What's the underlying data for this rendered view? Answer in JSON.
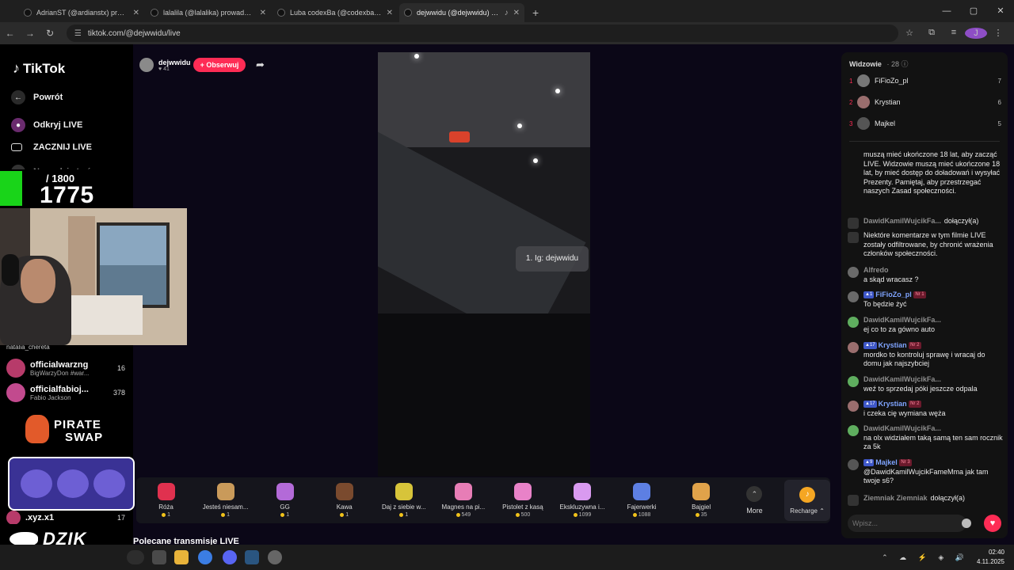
{
  "browser": {
    "tabs": [
      {
        "label": "AdrianST (@ardianstx) prowadzi LIVE",
        "active": false
      },
      {
        "label": "lalalila (@lalalika) prowadzi LIVE",
        "active": false
      },
      {
        "label": "Luba codexBa (@codexba369)",
        "active": false
      },
      {
        "label": "dejwwidu (@dejwwidu) prowadzi LIVE",
        "active": true
      }
    ],
    "url": "tiktok.com/@dejwwidu/live",
    "profile_initial": "J"
  },
  "sidebar": {
    "brand": "TikTok",
    "back_label": "Powrót",
    "discover_label": "Odkryj LIVE",
    "go_live_label": "ZACZNIJ LIVE",
    "creator_tools_label": "Narzędzia twórcy",
    "accounts": [
      {
        "name": "natalia_chereta",
        "sub": "",
        "count": ""
      },
      {
        "name": "officialwarzng",
        "sub": "BigWarzyDon #war...",
        "count": "16"
      },
      {
        "name": "officialfabioj...",
        "sub": "Fabio Jackson",
        "count": "378"
      },
      {
        "name": ".xyz.x1",
        "sub": "",
        "count": "17"
      }
    ]
  },
  "overlay": {
    "counter_total": "/ 1800",
    "counter_current": "1775",
    "pirate_line1": "PIRATE",
    "pirate_line2": "SWAP",
    "dzik_label": "DZIK"
  },
  "stream": {
    "host_name": "dejwwidu",
    "host_likes": "41",
    "follow_label": "+ Obserwuj",
    "tooltip": "1. Ig: dejwwidu",
    "recommended_label": "Polecane transmisje LIVE"
  },
  "gifts": [
    {
      "name": "Róża",
      "price": "1",
      "color": "#e0314f"
    },
    {
      "name": "Jesteś niesam...",
      "price": "1",
      "color": "#c99a5a"
    },
    {
      "name": "GG",
      "price": "1",
      "color": "#b36ad8"
    },
    {
      "name": "Kawa",
      "price": "1",
      "color": "#7a4a2e"
    },
    {
      "name": "Daj z siebie w...",
      "price": "1",
      "color": "#d7c43a"
    },
    {
      "name": "Magnes na pi...",
      "price": "549",
      "color": "#e77db6"
    },
    {
      "name": "Pistolet z kasą",
      "price": "500",
      "color": "#e882c8"
    },
    {
      "name": "Ekskluzywna i...",
      "price": "1099",
      "color": "#d99af0"
    },
    {
      "name": "Fajerwerki",
      "price": "1088",
      "color": "#5d7fe3"
    },
    {
      "name": "Bajgiel",
      "price": "35",
      "color": "#e0a24a"
    }
  ],
  "gift_more_label": "More",
  "recharge_label": "Recharge",
  "viewers": {
    "title": "Widzowie",
    "count": "28",
    "top": [
      {
        "rank": "1",
        "name": "FiFioZo_pl",
        "score": "7"
      },
      {
        "rank": "2",
        "name": "Krystian",
        "score": "6"
      },
      {
        "rank": "3",
        "name": "Majkel",
        "score": "5"
      }
    ]
  },
  "chat": [
    {
      "type": "system",
      "user": "",
      "text": "muszą mieć ukończone 18 lat, aby zacząć LIVE. Widzowie muszą mieć ukończone 18 lat, by mieć dostęp do doładowań i wysyłać Prezenty. Pamiętaj, aby przestrzegać naszych Zasad społeczności."
    },
    {
      "type": "join",
      "user": "DawidKamilWujcikFa...",
      "text": "dołączył(a)"
    },
    {
      "type": "system",
      "user": "",
      "text": "Niektóre komentarze w tym filmie LIVE zostały odfiltrowane, by chronić wrażenia członków społeczności."
    },
    {
      "type": "comment",
      "user": "Alfredo",
      "level": "",
      "nr": "",
      "text": "a skąd wracasz ?"
    },
    {
      "type": "comment",
      "user": "FiFioZo_pl",
      "level": "1",
      "nr": "Nr 1",
      "text": "To będzie żyć"
    },
    {
      "type": "comment",
      "user": "DawidKamilWujcikFa...",
      "level": "",
      "nr": "",
      "text": "ej co to za gówno auto"
    },
    {
      "type": "comment",
      "user": "Krystian",
      "level": "17",
      "nr": "Nr 2",
      "text": "mordko to kontroluj sprawę i wracaj do domu jak najszybciej"
    },
    {
      "type": "comment",
      "user": "DawidKamilWujcikFa...",
      "level": "",
      "nr": "",
      "text": "weź to sprzedaj póki jeszcze odpala"
    },
    {
      "type": "comment",
      "user": "Krystian",
      "level": "17",
      "nr": "Nr 2",
      "text": "i czeka cię wymiana węża"
    },
    {
      "type": "comment",
      "user": "DawidKamilWujcikFa...",
      "level": "",
      "nr": "",
      "text": "na olx widziałem taką samą ten sam rocznik za 5k"
    },
    {
      "type": "comment",
      "user": "Majkel",
      "level": "9",
      "nr": "Nr 3",
      "text": "@DawidKamilWujcikFameMma jak tam twoje s6?"
    },
    {
      "type": "join",
      "user": "Ziemniak Ziemniak",
      "text": "dołączył(a)"
    }
  ],
  "chat_placeholder": "Wpisz...",
  "taskbar": {
    "time": "02:40",
    "date": "4.11.2025"
  }
}
